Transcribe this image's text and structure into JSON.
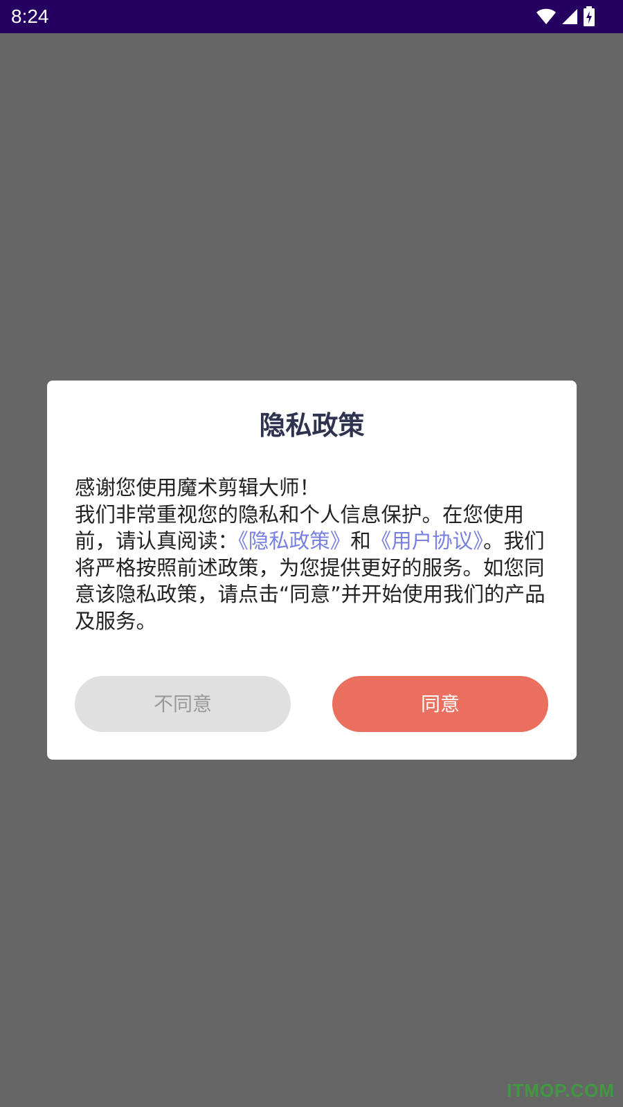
{
  "status_bar": {
    "time": "8:24",
    "icons": [
      "wifi-icon",
      "cell-signal-icon",
      "battery-charging-icon"
    ]
  },
  "dialog": {
    "title": "隐私政策",
    "body": {
      "line1": "感谢您使用魔术剪辑大师！",
      "part1": "我们非常重视您的隐私和个人信息保护。在您使用前，请认真阅读：",
      "privacy_link": "《隐私政策》",
      "conj": "和",
      "agreement_link": "《用户协议》",
      "part2": "。我们将严格按照前述政策，为您提供更好的服务。如您同意该隐私政策，请点击“同意”并开始使用我们的产品及服务。"
    },
    "buttons": {
      "disagree": "不同意",
      "agree": "同意"
    }
  },
  "watermark": "ITMOP.COM",
  "colors": {
    "status_bar": "#250061",
    "backdrop": "#666666",
    "link": "#7880e0",
    "agree_button": "#eb6f5e",
    "disagree_button": "#e0e0e0"
  }
}
